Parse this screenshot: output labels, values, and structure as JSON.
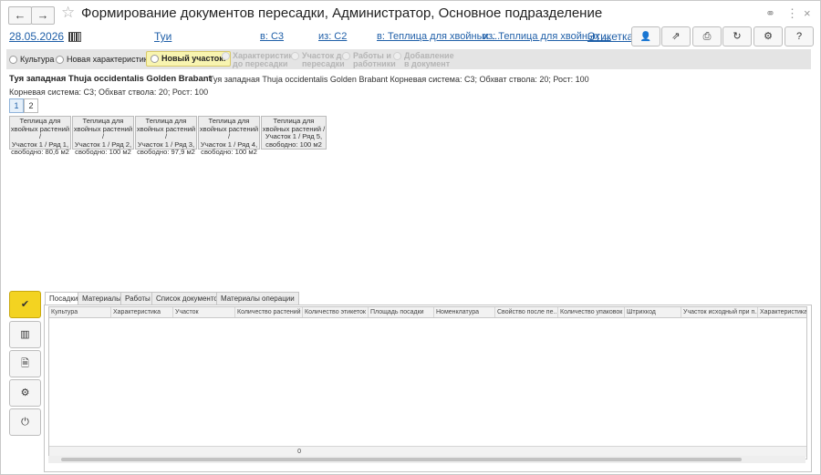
{
  "window": {
    "title": "Формирование документов пересадки, Администратор, Основное подразделение",
    "back_icon": "←",
    "forward_icon": "→",
    "star_icon": "☆",
    "link_icon": "⚭",
    "more_icon": "⋮",
    "close_icon": "×"
  },
  "header": {
    "date": "28.05.2026",
    "culture": "Туи",
    "to_variant": "в: С3",
    "from_variant": "из: С2",
    "to_location": "в: Теплица для хвойных ...",
    "from_location": "из: Теплица для хвойных ...",
    "label_link": "Этикетка"
  },
  "toolbar": {
    "user_icon": "👤",
    "arrow_icon": "⇗",
    "print_icon": "⎙",
    "refresh_icon": "↻",
    "settings_icon": "⚙",
    "help_label": "?"
  },
  "steps": [
    {
      "label": "Культура"
    },
    {
      "label": "Новая характеристика"
    },
    {
      "label": "Новый участок:"
    },
    {
      "line1": "Характеристика",
      "line2": "до пересадки"
    },
    {
      "line1": "Участок до",
      "line2": "пересадки"
    },
    {
      "line1": "Работы и",
      "line2": "работники"
    },
    {
      "line1": "Добавление",
      "line2": "в документ"
    }
  ],
  "product": {
    "title": "Туя западная Thuja occidentalis Golden Brabant",
    "subtitle": "Корневая система: С3; Обхват ствола: 20; Рост: 100",
    "right_line": "Туя западная Thuja occidentalis Golden Brabant  Корневая система: С3; Обхват ствола: 20; Рост: 100"
  },
  "pages": [
    "1",
    "2"
  ],
  "plots": [
    {
      "l1": "Теплица для",
      "l2": "хвойных растений /",
      "l3": "Участок 1 / Ряд 1,",
      "l4": "свободно: 80,6 м2"
    },
    {
      "l1": "Теплица для",
      "l2": "хвойных растений /",
      "l3": "Участок 1 / Ряд 2,",
      "l4": "свободно: 100 м2"
    },
    {
      "l1": "Теплица для",
      "l2": "хвойных растений /",
      "l3": "Участок 1 / Ряд 3,",
      "l4": "свободно: 97,9 м2"
    },
    {
      "l1": "Теплица для",
      "l2": "хвойных растений /",
      "l3": "Участок 1 / Ряд 4,",
      "l4": "свободно: 100 м2"
    },
    {
      "l1": "Теплица для",
      "l2": "хвойных растений /",
      "l3": "Участок 1 / Ряд 5,",
      "l4": "свободно: 100 м2"
    }
  ],
  "side_actions": {
    "confirm_icon": "✔",
    "barcode_icon": "▥",
    "doc_icon": "🗎",
    "gear_icon": "⚙",
    "power_icon": "⏻"
  },
  "tabs": [
    "Посадки",
    "Материалы",
    "Работы",
    "Список документов",
    "Материалы операции"
  ],
  "table": {
    "columns": [
      "Культура",
      "Характеристика",
      "Участок",
      "Количество растений",
      "Количество этикеток",
      "Площадь посадки",
      "Номенклатура",
      "Свойство после пе...",
      "Количество упаковок",
      "Штрихкод",
      "Участок исходный при п...",
      "Характеристика"
    ],
    "total": "0"
  },
  "colors": {
    "accent_yellow": "#f3d321",
    "link_blue": "#1f5fa8",
    "step_active": "#f8f4b0"
  }
}
